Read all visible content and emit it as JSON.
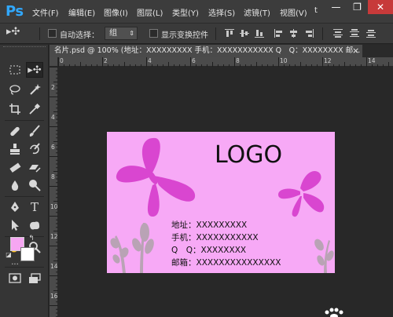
{
  "app": {
    "logo": "Ps"
  },
  "menu": [
    "文件(F)",
    "编辑(E)",
    "图像(I)",
    "图层(L)",
    "类型(Y)",
    "选择(S)",
    "滤镜(T)",
    "视图(V)",
    "t"
  ],
  "window_buttons": {
    "minimize": "—",
    "restore": "❐",
    "close": "✕"
  },
  "options": {
    "move_tool_icon": "▸✣",
    "auto_select_label": "自动选择：",
    "auto_select_value": "组",
    "show_transform_label": "显示变换控件"
  },
  "document": {
    "tab_title": "名片.psd @ 100% (地址：XXXXXXXXX 手机：XXXXXXXXXXX Q　Q：XXXXXXXX 邮...",
    "close": "×"
  },
  "rulers": {
    "top": [
      "0",
      "2",
      "4",
      "6",
      "8",
      "10",
      "12",
      "14"
    ],
    "left": [
      "2",
      "4",
      "6",
      "8",
      "10",
      "12",
      "14",
      "16"
    ]
  },
  "card": {
    "logo": "LOGO",
    "address": "地址：XXXXXXXXX",
    "phone": "手机：XXXXXXXXXXX",
    "qq": "Q　Q：XXXXXXXX",
    "email": "邮箱：XXXXXXXXXXXXXXX",
    "colors": {
      "background": "#f7a9f6",
      "butterfly": "#d946d0",
      "plant": "#b9a3b5"
    }
  },
  "tools": [
    "marquee-tool",
    "move-tool",
    "lasso-tool",
    "magic-wand-tool",
    "crop-tool",
    "eyedropper-tool",
    "spot-healing-tool",
    "brush-tool",
    "clone-stamp-tool",
    "history-brush-tool",
    "eraser-tool",
    "gradient-tool",
    "blur-tool",
    "dodge-tool",
    "pen-tool",
    "type-tool",
    "path-selection-tool",
    "custom-shape-tool",
    "hand-tool",
    "zoom-tool"
  ],
  "swatches": {
    "foreground": "#f6a6f2",
    "background": "#ffffff"
  }
}
